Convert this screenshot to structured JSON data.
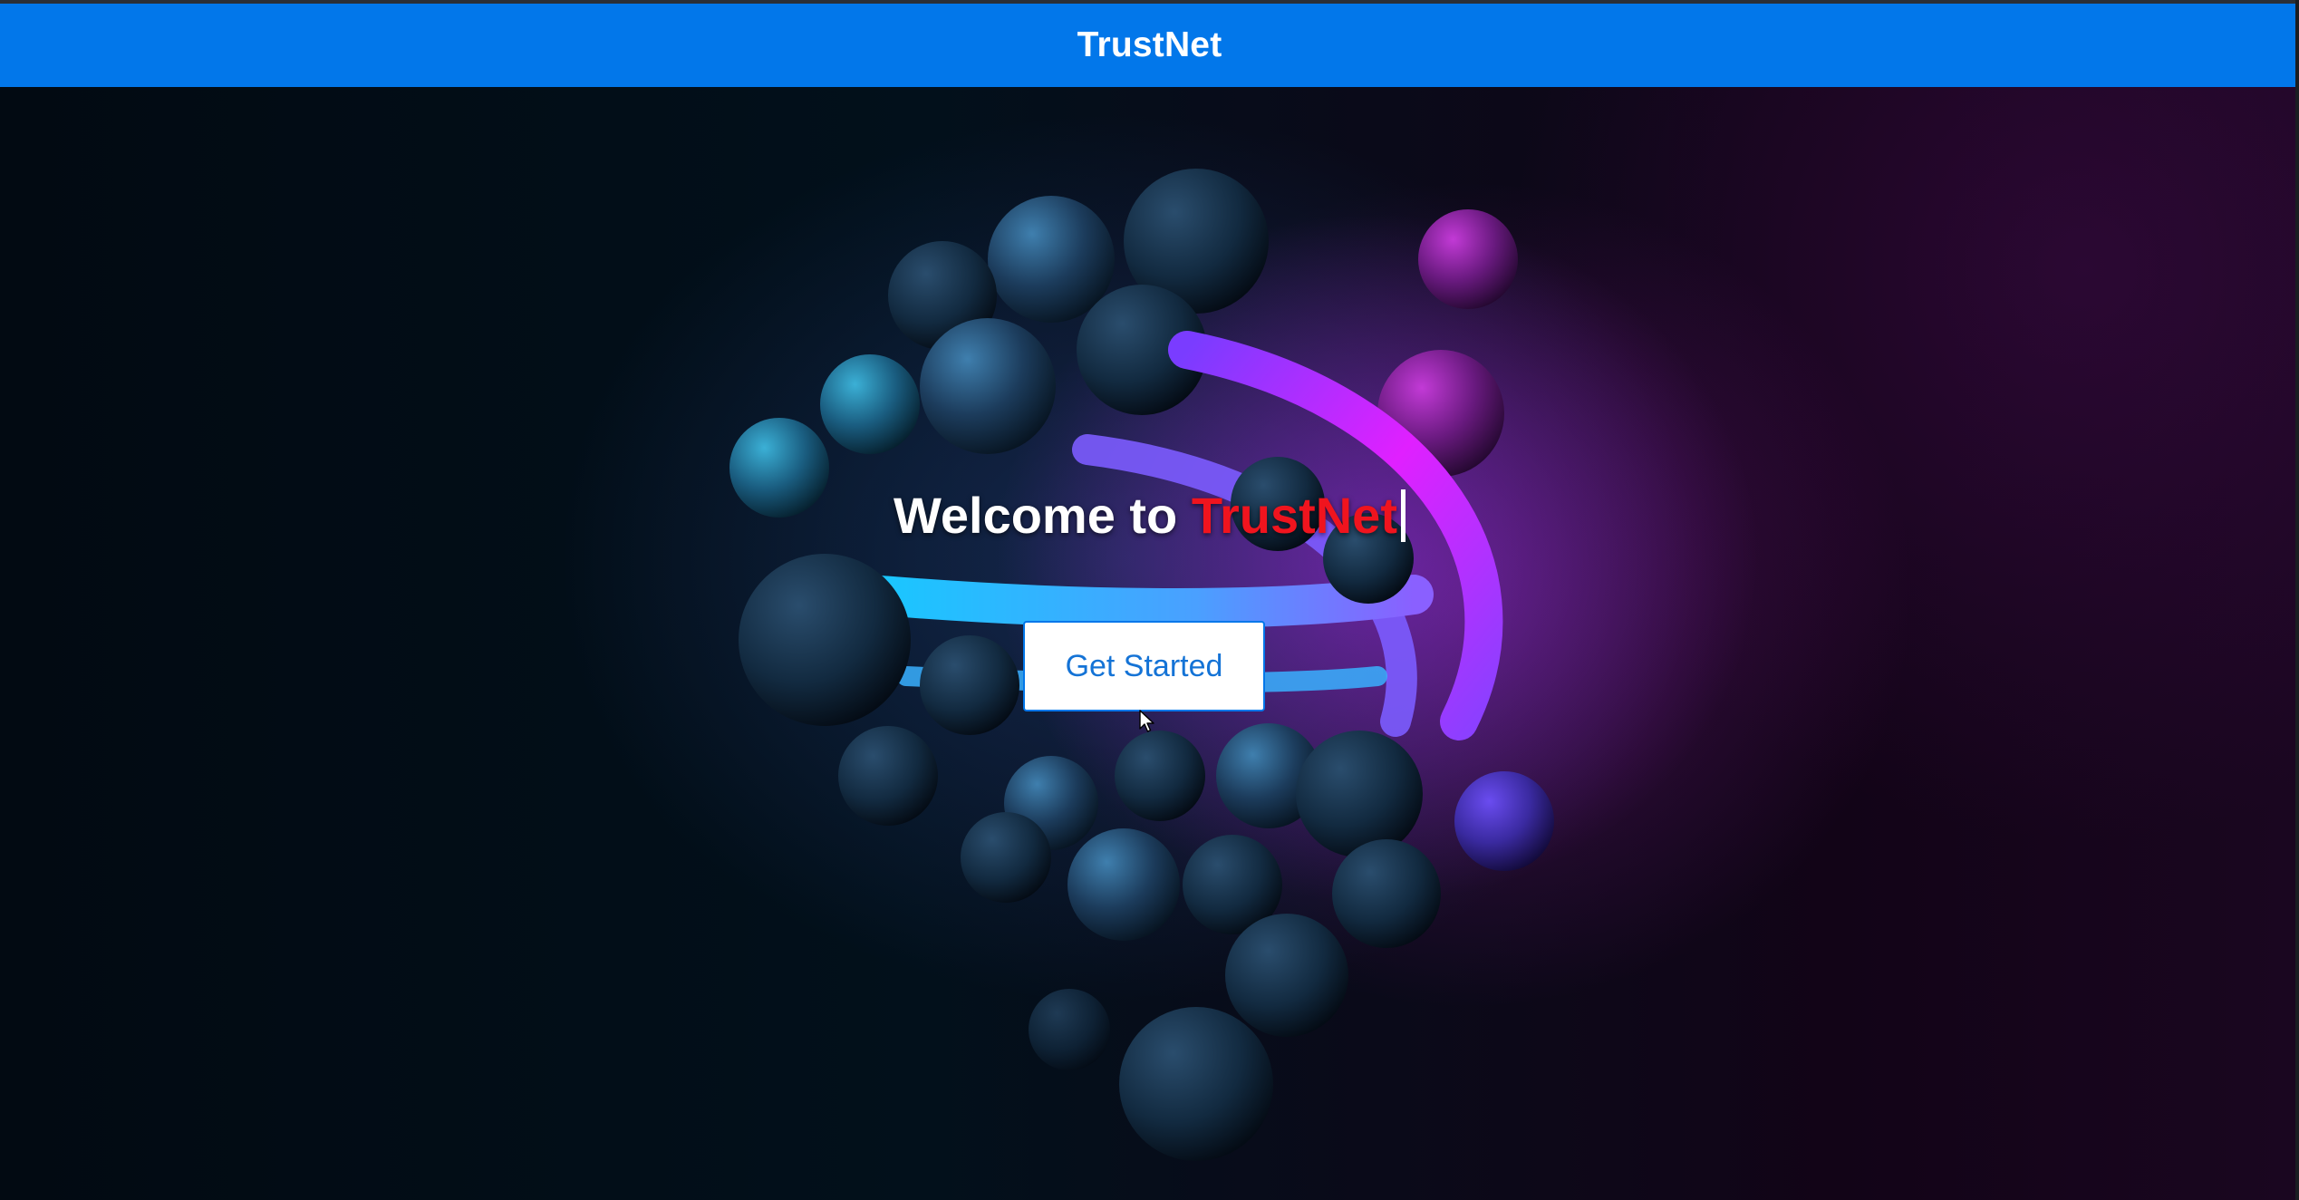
{
  "navbar": {
    "brand": "TrustNet",
    "color": "#0277ea"
  },
  "hero": {
    "welcome_prefix": "Welcome to ",
    "welcome_brand": "TrustNet",
    "brand_color": "#f0141e",
    "cta_label": "Get Started",
    "cta_text_color": "#1473d6"
  },
  "icons": {
    "cursor": "mouse-pointer-icon"
  }
}
